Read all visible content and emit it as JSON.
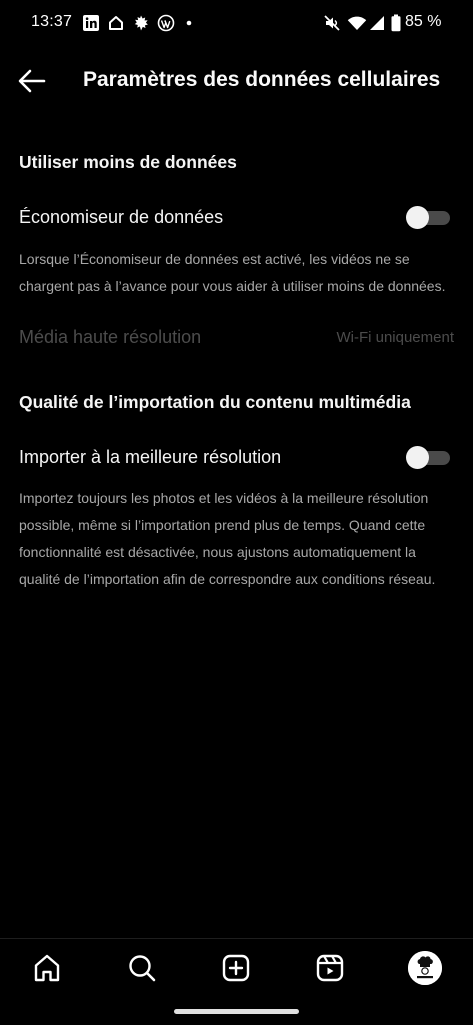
{
  "status_bar": {
    "time": "13:37",
    "battery": "85 %",
    "icons": [
      "linkedin-icon",
      "home-outline-icon",
      "leaf-icon",
      "wordpress-icon",
      "dot-icon",
      "mute-icon",
      "wifi-icon",
      "signal-icon",
      "battery-icon"
    ]
  },
  "header": {
    "back_icon": "arrow-left-icon",
    "title": "Paramètres des données cellulaires"
  },
  "sections": {
    "data_usage": {
      "title": "Utiliser moins de données",
      "data_saver": {
        "label": "Économiseur de données",
        "enabled": false,
        "description": "Lorsque l’Économiseur de données est activé, les vidéos ne se chargent pas à l’avance pour vous aider à utiliser moins de données."
      },
      "high_res_media": {
        "label": "Média haute résolution",
        "value": "Wi-Fi uniquement",
        "disabled": true
      }
    },
    "upload_quality": {
      "title": "Qualité de l’importation du contenu multimédia",
      "best_resolution": {
        "label": "Importer à la meilleure résolution",
        "enabled": false,
        "description": "Importez toujours les photos et les vidéos à la meilleure résolution possible, même si l’importation prend plus de temps. Quand cette fonctionnalité est désactivée, nous ajustons automatiquement la qualité de l’importation afin de correspondre aux conditions réseau."
      }
    }
  },
  "bottom_nav": {
    "items": [
      "home-icon",
      "search-icon",
      "create-icon",
      "reels-icon",
      "profile-avatar"
    ]
  },
  "colors": {
    "background": "#000000",
    "text_primary": "#f5f5f5",
    "text_secondary": "#a8a8a8",
    "text_disabled": "#4c4c4c",
    "toggle_track": "#4a4a4a",
    "toggle_thumb": "#f2f2f2"
  }
}
